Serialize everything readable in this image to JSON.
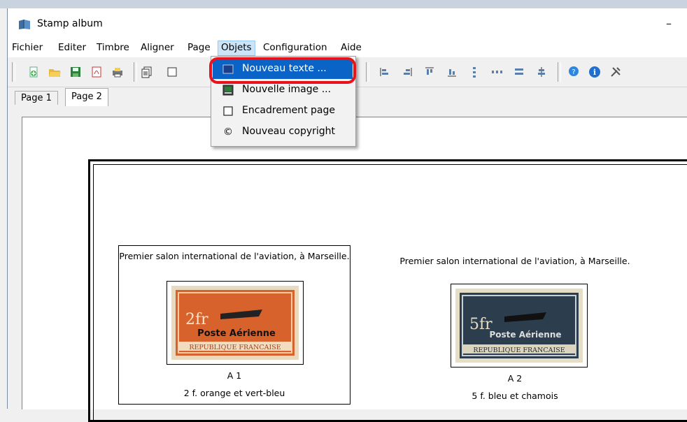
{
  "window": {
    "title": "Stamp album",
    "minimize": "–"
  },
  "menubar": {
    "items": [
      "Fichier",
      "Editer",
      "Timbre",
      "Aligner",
      "Page",
      "Objets",
      "Configuration",
      "Aide"
    ]
  },
  "tabs": [
    "Page 1",
    "Page 2"
  ],
  "dropdown": {
    "items": [
      {
        "label": "Nouveau texte ...",
        "icon": "text-object-icon"
      },
      {
        "label": "Nouvelle image ...",
        "icon": "image-icon"
      },
      {
        "label": "Encadrement page",
        "icon": "checkbox-icon"
      },
      {
        "label": "Nouveau copyright",
        "icon": "copyright-icon",
        "glyph": "©"
      }
    ]
  },
  "stamps": [
    {
      "header": "Premier salon international de l'aviation, à Marseille.",
      "code": "A 1",
      "desc": "2 f. orange et vert-bleu",
      "color": "#d7622c",
      "value_text": "2fr",
      "overprint": "Poste Aérienne",
      "country": "REPUBLIQUE FRANCAISE"
    },
    {
      "header": "Premier salon international de l'aviation, à Marseille.",
      "code": "A 2",
      "desc": "5 f. bleu et chamois",
      "color": "#2c3e4e",
      "value_text": "5fr",
      "overprint": "Poste Aérienne",
      "country": "REPUBLIQUE FRANCAISE"
    }
  ],
  "colors": {
    "highlight": "#0a64c8",
    "annotation_ring": "#e8131b",
    "menu_open_bg": "#cce4f7"
  }
}
